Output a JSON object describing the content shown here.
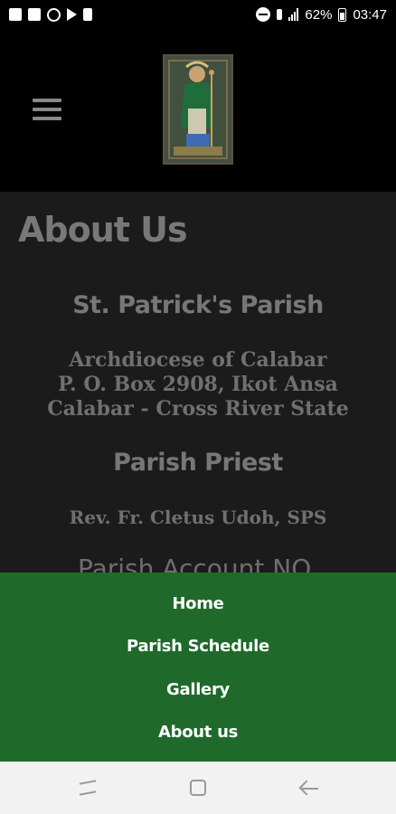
{
  "status_bar": {
    "battery": "62%",
    "time": "03:47"
  },
  "header": {
    "logo_alt": "St. Patrick image"
  },
  "main": {
    "title": "About Us",
    "parish_name": "St. Patrick's Parish",
    "address": [
      "Archdiocese of Calabar",
      "P. O. Box 2908, Ikot Ansa",
      "Calabar - Cross River State"
    ],
    "priest_heading": "Parish Priest",
    "priest_name": "Rev. Fr. Cletus Udoh, SPS",
    "account_heading": "Parish Account NO."
  },
  "bottom_menu": {
    "items": [
      "Home",
      "Parish Schedule",
      "Gallery",
      "About us"
    ]
  },
  "colors": {
    "menu_background": "#1f6a2a",
    "header_background": "#000000",
    "content_background": "#1b1b1b"
  }
}
